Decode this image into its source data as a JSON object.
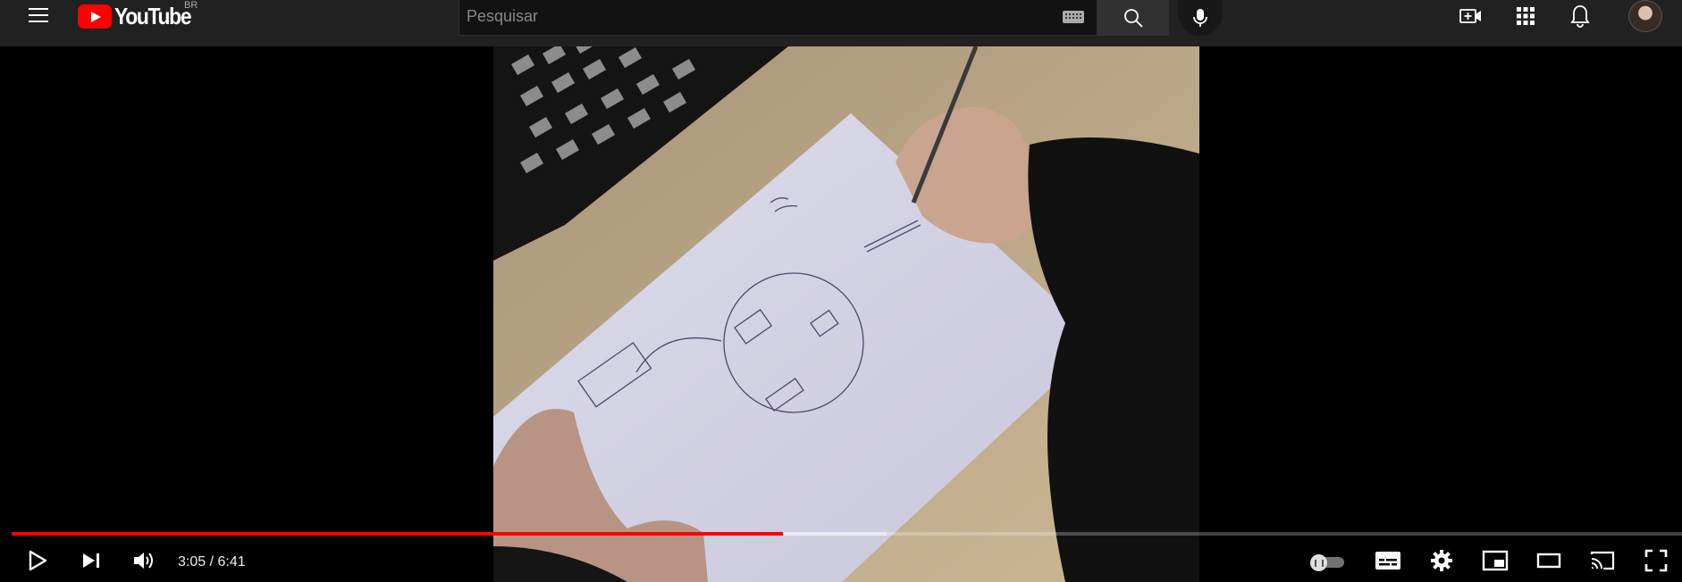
{
  "header": {
    "logo_text": "YouTube",
    "country_code": "BR",
    "search": {
      "placeholder": "Pesquisar",
      "value": ""
    },
    "icons": [
      "menu-icon",
      "keyboard-icon",
      "search-icon",
      "mic-icon",
      "create-video-icon",
      "apps-grid-icon",
      "notifications-bell-icon",
      "avatar"
    ]
  },
  "player": {
    "time": {
      "current": "3:05",
      "duration": "6:41",
      "display": "3:05 / 6:41"
    },
    "progress_fraction": 0.462,
    "buffered_fraction": 0.524,
    "autoplay": "on",
    "progress_color": "#ff0000",
    "control_icons": [
      "play-icon",
      "next-icon",
      "volume-icon",
      "autoplay-toggle",
      "subtitles-icon",
      "settings-gear-icon",
      "miniplayer-icon",
      "theater-mode-icon",
      "cast-icon",
      "fullscreen-icon"
    ]
  }
}
